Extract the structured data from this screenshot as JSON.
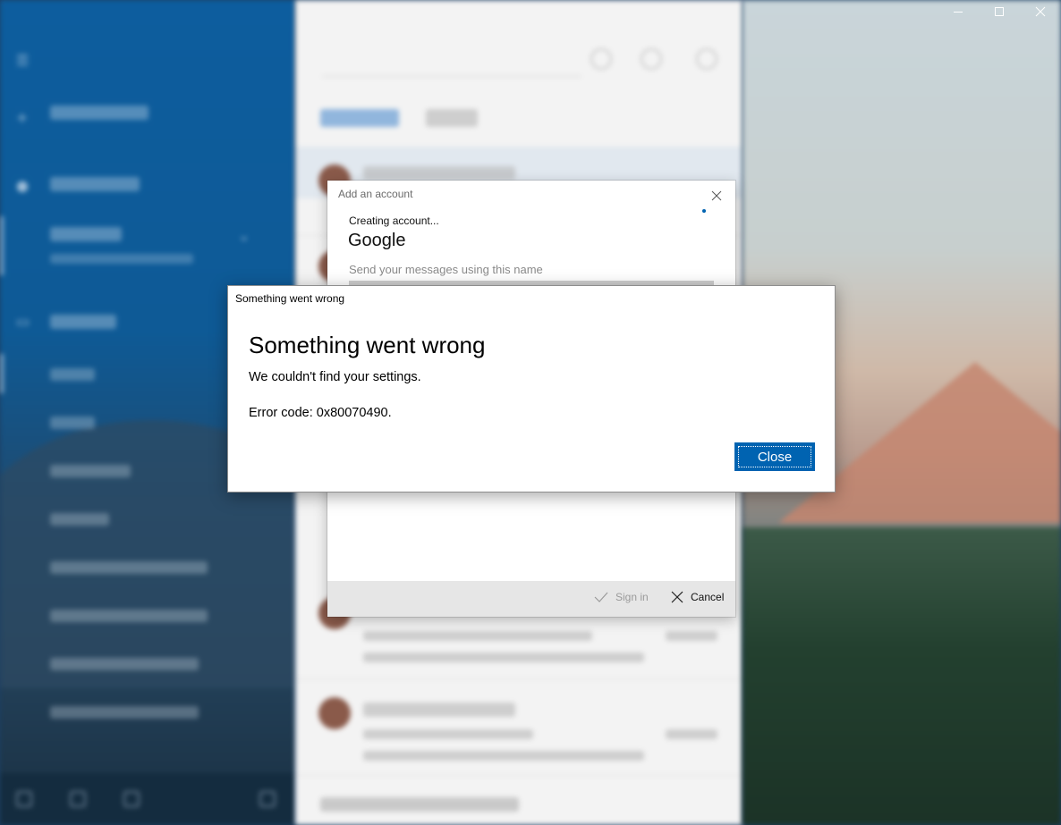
{
  "window_controls": {
    "minimize": "minimize-icon",
    "maximize": "maximize-icon",
    "close": "close-icon"
  },
  "add_account_dialog": {
    "title": "Add an account",
    "status": "Creating account...",
    "provider": "Google",
    "send_label": "Send your messages using this name",
    "sign_in_label": "Sign in",
    "cancel_label": "Cancel"
  },
  "error_dialog": {
    "title": "Something went wrong",
    "heading": "Something went wrong",
    "message": "We couldn't find your settings.",
    "error_code": "Error code: 0x80070490.",
    "close_label": "Close"
  },
  "colors": {
    "accent": "#0063b1",
    "sidebar": "#0d5d9e",
    "list_bg": "#f3f3f3"
  }
}
